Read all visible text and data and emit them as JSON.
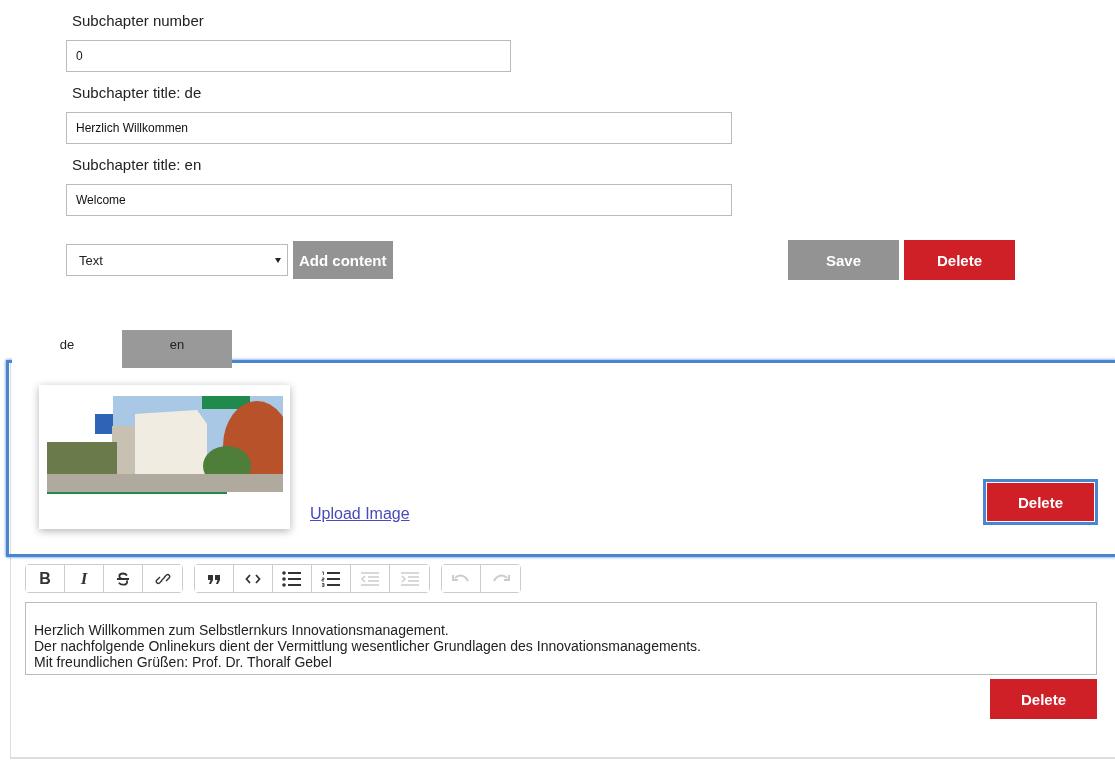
{
  "form": {
    "fields": [
      {
        "label": "Subchapter number",
        "value": "0",
        "kind": "short"
      },
      {
        "label": "Subchapter title: de",
        "value": "Herzlich Willkommen",
        "kind": "long"
      },
      {
        "label": "Subchapter title: en",
        "value": "Welcome",
        "kind": "long"
      }
    ],
    "content_type": {
      "value": "Text"
    },
    "add_button": "Add content",
    "save_button": "Save",
    "delete_button": "Delete"
  },
  "tabs": [
    {
      "label": "de",
      "selected": true
    },
    {
      "label": "en",
      "selected": false
    }
  ],
  "image_block": {
    "focused": true,
    "upload_link": "Upload Image",
    "delete_button": "Delete",
    "delete_focused": true
  },
  "toolbar": {
    "groups": [
      [
        {
          "kind": "bold",
          "label": "B",
          "disabled": false
        },
        {
          "kind": "italic",
          "label": "I",
          "disabled": false
        },
        {
          "kind": "strike",
          "disabled": false
        },
        {
          "kind": "link",
          "disabled": false
        }
      ],
      [
        {
          "kind": "quote",
          "disabled": false
        },
        {
          "kind": "code",
          "disabled": false
        },
        {
          "kind": "bullets",
          "disabled": false
        },
        {
          "kind": "numbers",
          "disabled": false
        },
        {
          "kind": "outdent",
          "disabled": true
        },
        {
          "kind": "indent",
          "disabled": true
        }
      ],
      [
        {
          "kind": "undo",
          "disabled": true
        },
        {
          "kind": "redo",
          "disabled": true
        }
      ]
    ]
  },
  "text_block": {
    "lines": [
      "Herzlich Willkommen zum Selbstlernkurs Innovationsmanagement.",
      "Der nachfolgende Onlinekurs dient der Vermittlung wesentlicher Grundlagen des Innovationsmanagements.",
      "Mit freundlichen Grüßen: Prof. Dr. Thoralf Gebel"
    ],
    "delete_button": "Delete"
  }
}
